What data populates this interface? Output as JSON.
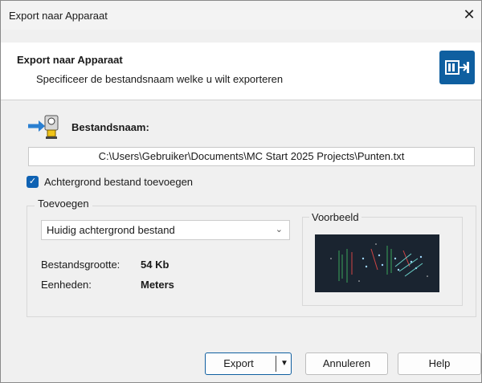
{
  "window": {
    "title": "Export naar Apparaat",
    "close_glyph": "✕"
  },
  "header": {
    "title": "Export naar Apparaat",
    "subtitle": "Specificeer de bestandsnaam welke u wilt exporteren",
    "logo_icon": "device-export-icon",
    "accent": "#0f5fa0"
  },
  "file": {
    "icon": "surveying-instrument-import-icon",
    "label": "Bestandsnaam:",
    "path": "C:\\Users\\Gebruiker\\Documents\\MC Start 2025 Projects\\Punten.txt"
  },
  "background_option": {
    "checked": true,
    "label": "Achtergrond bestand toevoegen"
  },
  "add_group": {
    "legend": "Toevoegen",
    "select_value": "Huidig achtergrond bestand",
    "size_label": "Bestandsgrootte:",
    "size_value": "54 Kb",
    "units_label": "Eenheden:",
    "units_value": "Meters",
    "preview_legend": "Voorbeeld"
  },
  "buttons": {
    "export": "Export",
    "cancel": "Annuleren",
    "help": "Help"
  }
}
